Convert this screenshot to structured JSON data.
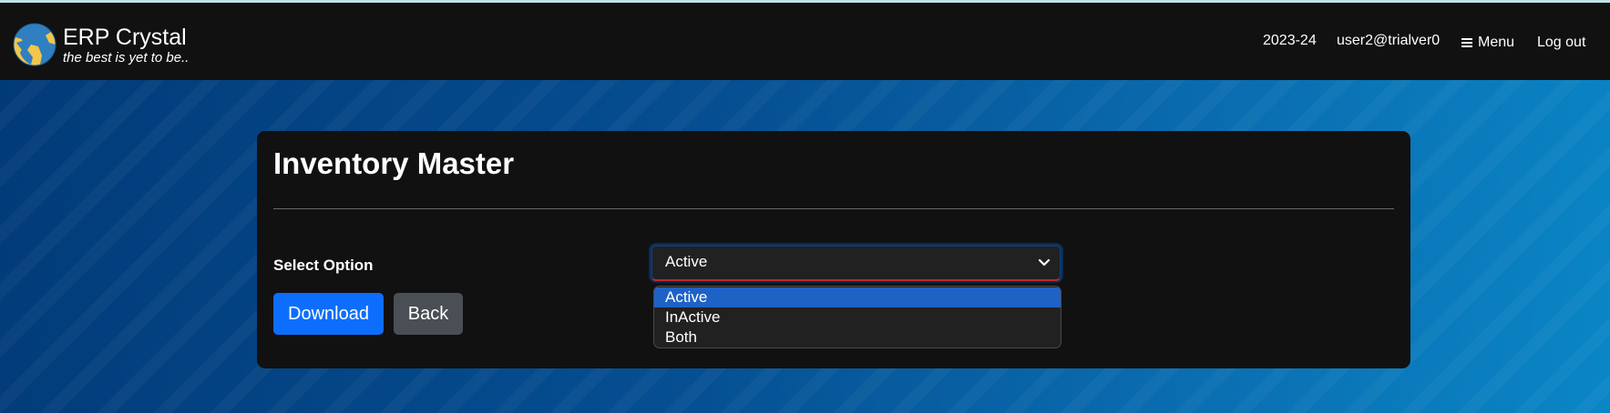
{
  "app": {
    "name": "ERP Crystal",
    "tagline": "the best is yet to be.."
  },
  "nav": {
    "year": "2023-24",
    "user": "user2@trialver0",
    "menu_label": "Menu",
    "logout_label": "Log out"
  },
  "page": {
    "title": "Inventory Master"
  },
  "form": {
    "select_label": "Select Option",
    "select_value": "Active",
    "options": [
      "Active",
      "InActive",
      "Both"
    ],
    "highlighted_option": "Active"
  },
  "buttons": {
    "download_label": "Download",
    "back_label": "Back"
  },
  "colors": {
    "navbar": "#111111",
    "card": "#111111",
    "primary_button": "#0d6efd",
    "secondary_button": "#4a4f55",
    "option_highlight": "#1f62c6"
  },
  "icons": {
    "logo": "globe-icon",
    "menu": "hamburger-icon",
    "select": "chevron-down-icon"
  }
}
